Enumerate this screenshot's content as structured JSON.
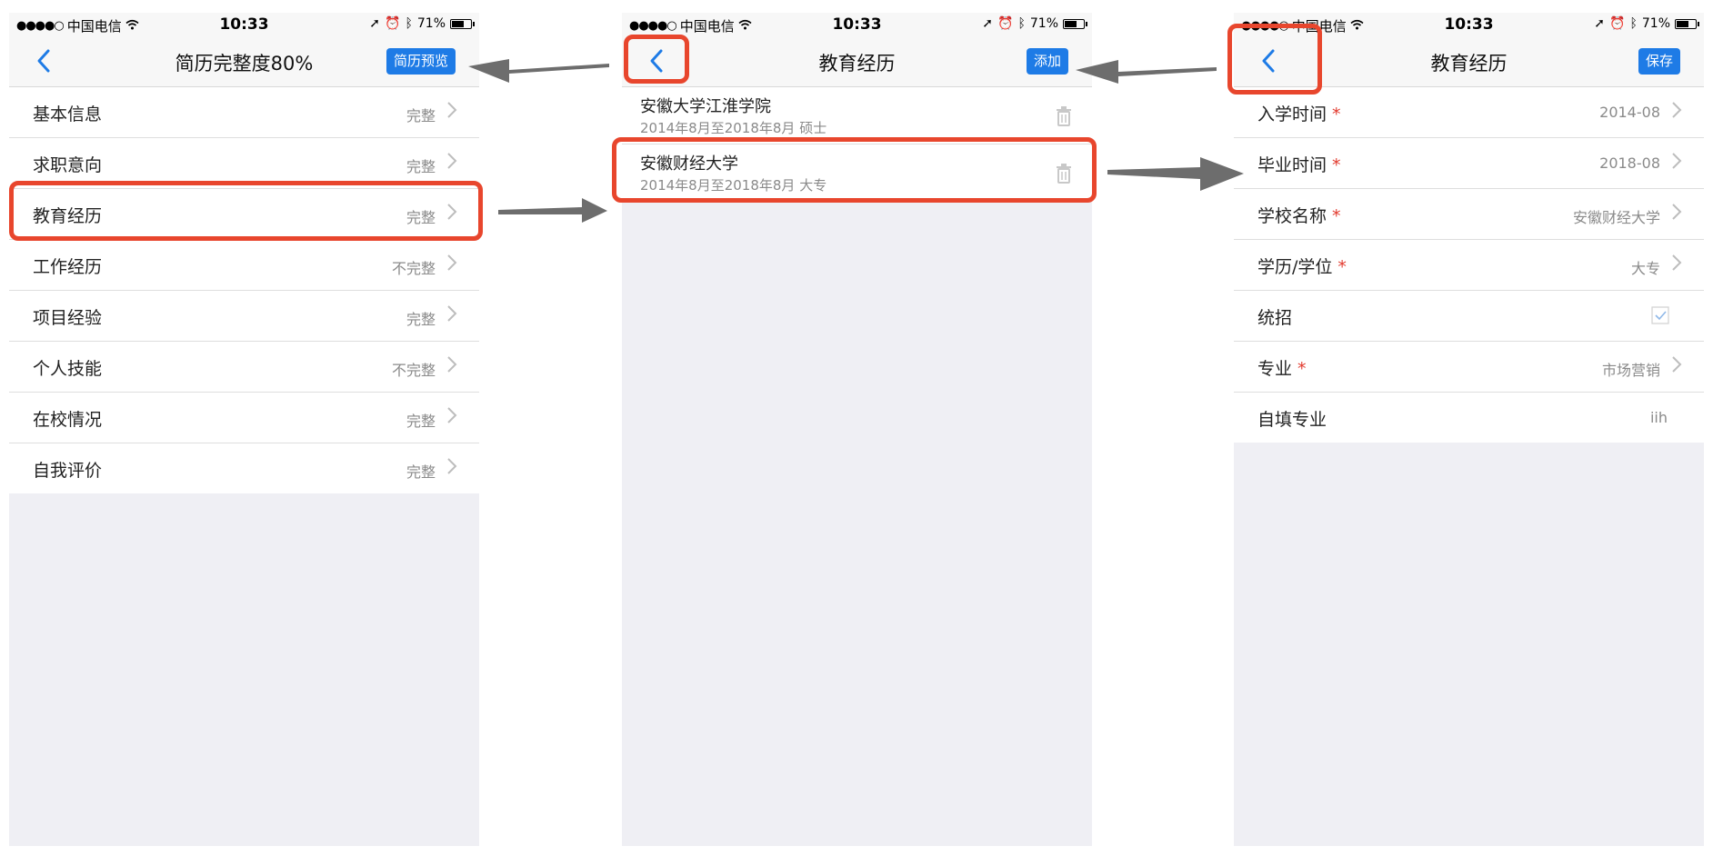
{
  "statusbar": {
    "carrier": "中国电信",
    "time": "10:33",
    "battery": "71%",
    "battery_level": 0.71
  },
  "screen1": {
    "title": "简历完整度80%",
    "action_label": "简历预览",
    "rows": [
      {
        "label": "基本信息",
        "status": "完整"
      },
      {
        "label": "求职意向",
        "status": "完整"
      },
      {
        "label": "教育经历",
        "status": "完整"
      },
      {
        "label": "工作经历",
        "status": "不完整"
      },
      {
        "label": "项目经验",
        "status": "完整"
      },
      {
        "label": "个人技能",
        "status": "不完整"
      },
      {
        "label": "在校情况",
        "status": "完整"
      },
      {
        "label": "自我评价",
        "status": "完整"
      }
    ]
  },
  "screen2": {
    "title": "教育经历",
    "action_label": "添加",
    "items": [
      {
        "school": "安徽大学江淮学院",
        "detail": "2014年8月至2018年8月  硕士"
      },
      {
        "school": "安徽财经大学",
        "detail": "2014年8月至2018年8月  大专"
      }
    ]
  },
  "screen3": {
    "title": "教育经历",
    "action_label": "保存",
    "required_mark": "*",
    "fields": [
      {
        "label": "入学时间",
        "value": "2014-08"
      },
      {
        "label": "毕业时间",
        "value": "2018-08"
      },
      {
        "label": "学校名称",
        "value": "安徽财经大学"
      },
      {
        "label": "学历/学位",
        "value": "大专"
      },
      {
        "label": "统招",
        "checked": true
      },
      {
        "label": "专业",
        "value": "市场营销"
      },
      {
        "label": "自填专业",
        "value": "iih"
      }
    ]
  },
  "colors": {
    "accent": "#1e7be6",
    "highlight": "#e8462d",
    "arrow": "#6d6d6d",
    "required": "#e23a2e"
  }
}
